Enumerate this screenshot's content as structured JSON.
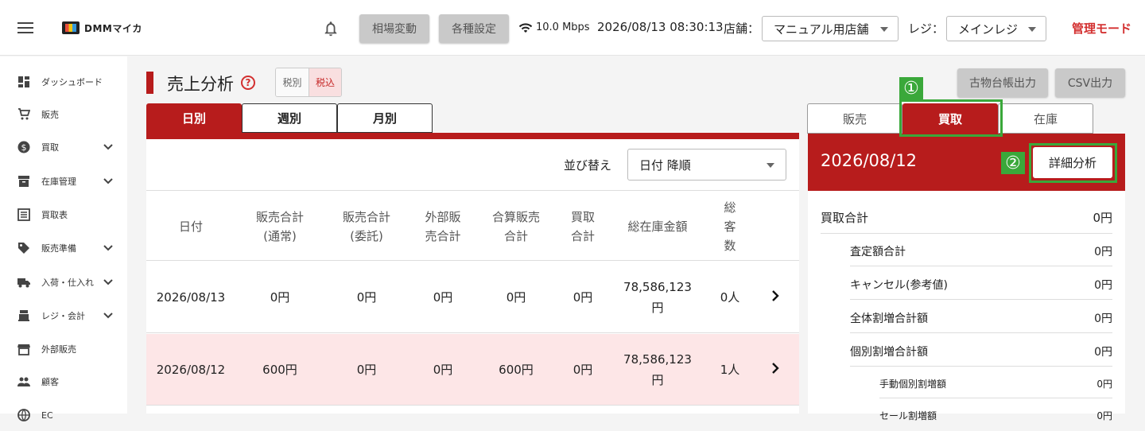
{
  "header": {
    "logo_text": "DMMマイカ",
    "btn_souba": "相場変動",
    "btn_settei": "各種設定",
    "speed": "10.0 Mbps",
    "datetime": "2026/08/13 08:30:13",
    "store_label": "店舗：",
    "store_value": "マニュアル用店舗",
    "reji_label": "レジ：",
    "reji_value": "メインレジ",
    "admin_mode": "管理モード"
  },
  "sidebar": {
    "items": [
      {
        "label": "ダッシュボード",
        "icon": "dashboard-icon"
      },
      {
        "label": "販売",
        "icon": "cart-icon"
      },
      {
        "label": "買取",
        "icon": "dollar-icon"
      },
      {
        "label": "在庫管理",
        "icon": "box-icon"
      },
      {
        "label": "買取表",
        "icon": "list-icon"
      },
      {
        "label": "販売準備",
        "icon": "tag-icon"
      },
      {
        "label": "入荷・仕入れ",
        "icon": "truck-icon"
      },
      {
        "label": "レジ・会計",
        "icon": "register-icon"
      },
      {
        "label": "外部販売",
        "icon": "store-icon"
      },
      {
        "label": "顧客",
        "icon": "people-icon"
      },
      {
        "label": "EC",
        "icon": "globe-icon"
      }
    ]
  },
  "main": {
    "title": "売上分析",
    "tax_excl": "税別",
    "tax_incl": "税込",
    "tabs": [
      "日別",
      "週別",
      "月別"
    ],
    "sort_label": "並び替え",
    "sort_value": "日付 降順",
    "columns": [
      "日付",
      "販売合計\n(通常)",
      "販売合計\n(委託)",
      "外部販\n売合計",
      "合算販売\n合計",
      "買取\n合計",
      "総在庫金額",
      "総\n客\n数"
    ],
    "rows": [
      {
        "date": "2026/08/13",
        "sales_normal": "0円",
        "sales_consign": "0円",
        "external": "0円",
        "combined": "0円",
        "purchase": "0円",
        "stock_value": "78,586,123\n円",
        "customers": "0人"
      },
      {
        "date": "2026/08/12",
        "sales_normal": "600円",
        "sales_consign": "0円",
        "external": "0円",
        "combined": "600円",
        "purchase": "0円",
        "stock_value": "78,586,123\n円",
        "customers": "1人"
      }
    ]
  },
  "right": {
    "kobutsu_btn": "古物台帳出力",
    "csv_btn": "CSV出力",
    "marker1": "①",
    "marker2": "②",
    "tabs": [
      "販売",
      "買取",
      "在庫"
    ],
    "date": "2026/08/12",
    "detail_btn": "詳細分析",
    "lines": [
      {
        "label": "買取合計",
        "value": "0円"
      },
      {
        "label": "査定額合計",
        "value": "0円"
      },
      {
        "label": "キャンセル(参考値)",
        "value": "0円"
      },
      {
        "label": "全体割増合計額",
        "value": "0円"
      },
      {
        "label": "個別割増合計額",
        "value": "0円"
      },
      {
        "label": "手動個別割増額",
        "value": "0円"
      },
      {
        "label": "セール割増額",
        "value": "0円"
      }
    ]
  },
  "colors": {
    "accent": "#b71c1c",
    "annotation": "#3aa83a",
    "highlight_row": "#fde6e7"
  }
}
